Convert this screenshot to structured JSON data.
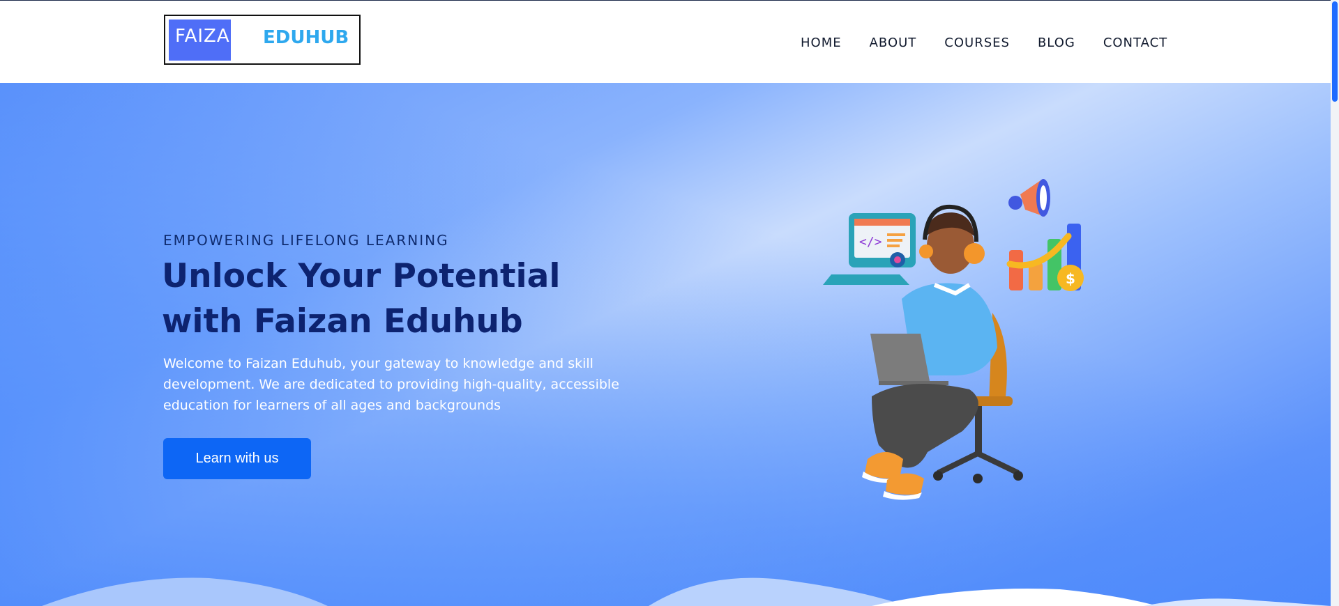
{
  "brand": {
    "part_one": "FAIZAN",
    "part_two": "EDUHUB",
    "colors": {
      "box": "#4f6ef7",
      "accent": "#2ea8ee"
    }
  },
  "nav": {
    "items": [
      {
        "label": "HOME"
      },
      {
        "label": "ABOUT"
      },
      {
        "label": "COURSES"
      },
      {
        "label": "BLOG"
      },
      {
        "label": "CONTACT"
      }
    ]
  },
  "hero": {
    "eyebrow": "EMPOWERING LIFELONG LEARNING",
    "title": "Unlock Your Potential with Faizan Eduhub",
    "description": "Welcome to Faizan Eduhub, your gateway to knowledge and skill development. We are dedicated to providing high-quality, accessible education for learners of all ages and backgrounds",
    "cta_label": "Learn with us",
    "illustration": "student-with-laptop-and-headset-illustration",
    "colors": {
      "title": "#0d2370",
      "button": "#0d66f5"
    }
  }
}
